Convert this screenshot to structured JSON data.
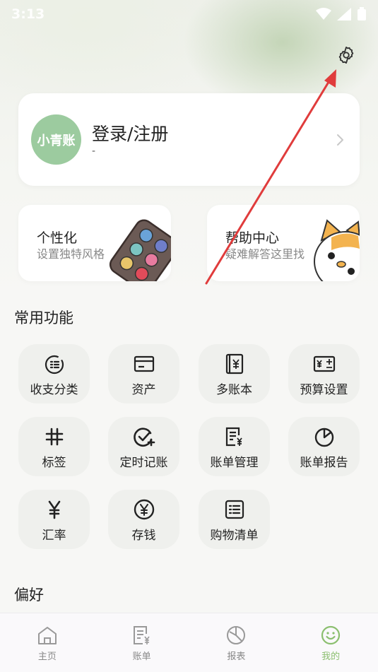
{
  "status_bar": {
    "time": "3:13"
  },
  "profile": {
    "avatar_text": "小青账",
    "title": "登录/注册",
    "subtitle": "-"
  },
  "feature_cards": [
    {
      "title": "个性化",
      "subtitle": "设置独特风格"
    },
    {
      "title": "帮助中心",
      "subtitle": "疑难解答这里找"
    }
  ],
  "sections": {
    "common": "常用功能",
    "preferences": "偏好"
  },
  "functions": [
    {
      "label": "收支分类",
      "icon": "category-icon"
    },
    {
      "label": "资产",
      "icon": "card-icon"
    },
    {
      "label": "多账本",
      "icon": "ledger-book-icon"
    },
    {
      "label": "预算设置",
      "icon": "budget-icon"
    },
    {
      "label": "标签",
      "icon": "hashtag-icon"
    },
    {
      "label": "定时记账",
      "icon": "check-plus-icon"
    },
    {
      "label": "账单管理",
      "icon": "bill-manage-icon"
    },
    {
      "label": "账单报告",
      "icon": "pie-report-icon"
    },
    {
      "label": "汇率",
      "icon": "yen-icon"
    },
    {
      "label": "存钱",
      "icon": "coin-icon"
    },
    {
      "label": "购物清单",
      "icon": "list-icon"
    }
  ],
  "tabs": [
    {
      "label": "主页",
      "icon": "home-icon"
    },
    {
      "label": "账单",
      "icon": "bill-icon"
    },
    {
      "label": "报表",
      "icon": "chart-icon"
    },
    {
      "label": "我的",
      "icon": "smile-icon",
      "active": true
    }
  ],
  "colors": {
    "accent": "#8bbf6f",
    "avatar": "#9ccb9f",
    "annotation_arrow": "#e03c3c"
  }
}
